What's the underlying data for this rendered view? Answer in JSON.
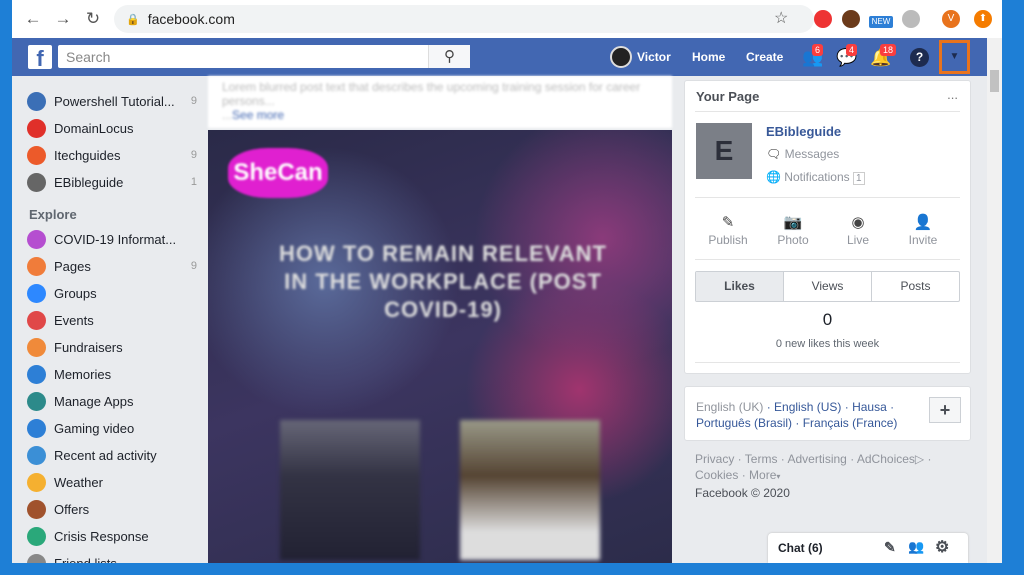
{
  "browser": {
    "url": "facebook.com",
    "ext_new": "NEW",
    "profile_initial": "V"
  },
  "header": {
    "search_placeholder": "Search",
    "user": "Victor",
    "home": "Home",
    "create": "Create",
    "friend_requests": "6",
    "messages": "4",
    "notifications": "18",
    "help": "?"
  },
  "sidebar": {
    "shortcuts": [
      {
        "label": "Powershell Tutorial...",
        "count": "9",
        "color": "#3b6fb6"
      },
      {
        "label": "DomainLocus",
        "count": "",
        "color": "#e0302a"
      },
      {
        "label": "Itechguides",
        "count": "9",
        "color": "#ec5a2a"
      },
      {
        "label": "EBibleguide",
        "count": "1",
        "color": "#666"
      }
    ],
    "explore_label": "Explore",
    "explore": [
      {
        "label": "COVID-19 Informat...",
        "count": "",
        "color": "#b54ed0"
      },
      {
        "label": "Pages",
        "count": "9",
        "color": "#f07c3a"
      },
      {
        "label": "Groups",
        "count": "",
        "color": "#2d88ff"
      },
      {
        "label": "Events",
        "count": "",
        "color": "#e04848"
      },
      {
        "label": "Fundraisers",
        "count": "",
        "color": "#f08a3a"
      },
      {
        "label": "Memories",
        "count": "",
        "color": "#2d7fd6"
      },
      {
        "label": "Manage Apps",
        "count": "",
        "color": "#2c8a8a"
      },
      {
        "label": "Gaming video",
        "count": "",
        "color": "#2d7fd6"
      },
      {
        "label": "Recent ad activity",
        "count": "",
        "color": "#3b8fd6"
      },
      {
        "label": "Weather",
        "count": "",
        "color": "#f5b030"
      },
      {
        "label": "Offers",
        "count": "",
        "color": "#a0522d"
      },
      {
        "label": "Crisis Response",
        "count": "",
        "color": "#2aa87a"
      },
      {
        "label": "Friend lists",
        "count": "",
        "color": "#888"
      }
    ]
  },
  "post": {
    "brand": "SheCan",
    "headline": "HOW TO REMAIN RELEVANT IN THE WORKPLACE (POST COVID-19)",
    "more": "See more"
  },
  "your_page": {
    "title": "Your Page",
    "more": "...",
    "avatar": "E",
    "name": "EBibleguide",
    "messages": "Messages",
    "notifications": "Notifications",
    "notif_count": "1",
    "actions": [
      "Publish",
      "Photo",
      "Live",
      "Invite"
    ],
    "tabs": [
      "Likes",
      "Views",
      "Posts"
    ],
    "likes_value": "0",
    "likes_caption": "0 new likes this week"
  },
  "languages": {
    "current": "English (UK)",
    "others": [
      "English (US)",
      "Hausa",
      "Português (Brasil)",
      "Français (France)"
    ],
    "add": "+"
  },
  "footer": {
    "links": [
      "Privacy",
      "Terms",
      "Advertising",
      "AdChoices",
      "Cookies",
      "More"
    ],
    "copyright": "Facebook © 2020"
  },
  "chat": {
    "label": "Chat (6)"
  }
}
